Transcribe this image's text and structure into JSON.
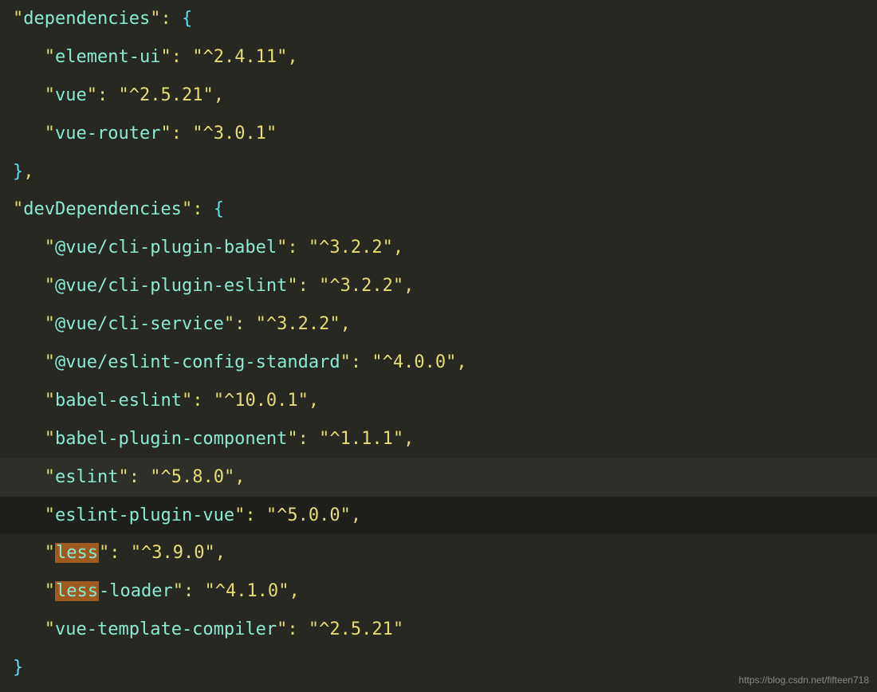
{
  "json": {
    "section1_key": "dependencies",
    "deps": [
      {
        "key": "element-ui",
        "val": "^2.4.11"
      },
      {
        "key": "vue",
        "val": "^2.5.21"
      },
      {
        "key": "vue-router",
        "val": "^3.0.1"
      }
    ],
    "section2_key": "devDependencies",
    "devDeps": [
      {
        "key": "@vue/cli-plugin-babel",
        "val": "^3.2.2"
      },
      {
        "key": "@vue/cli-plugin-eslint",
        "val": "^3.2.2"
      },
      {
        "key": "@vue/cli-service",
        "val": "^3.2.2"
      },
      {
        "key": "@vue/eslint-config-standard",
        "val": "^4.0.0"
      },
      {
        "key": "babel-eslint",
        "val": "^10.0.1"
      },
      {
        "key": "babel-plugin-component",
        "val": "^1.1.1"
      },
      {
        "key": "eslint",
        "val": "^5.8.0"
      },
      {
        "key": "eslint-plugin-vue",
        "val": "^5.0.0"
      },
      {
        "key": "less",
        "val": "^3.9.0",
        "hl_key_prefix": "less"
      },
      {
        "key": "less-loader",
        "val": "^4.1.0",
        "hl_key_prefix": "less",
        "key_suffix": "-loader"
      },
      {
        "key": "vue-template-compiler",
        "val": "^2.5.21"
      }
    ]
  },
  "watermark": "https://blog.csdn.net/fifteen718"
}
